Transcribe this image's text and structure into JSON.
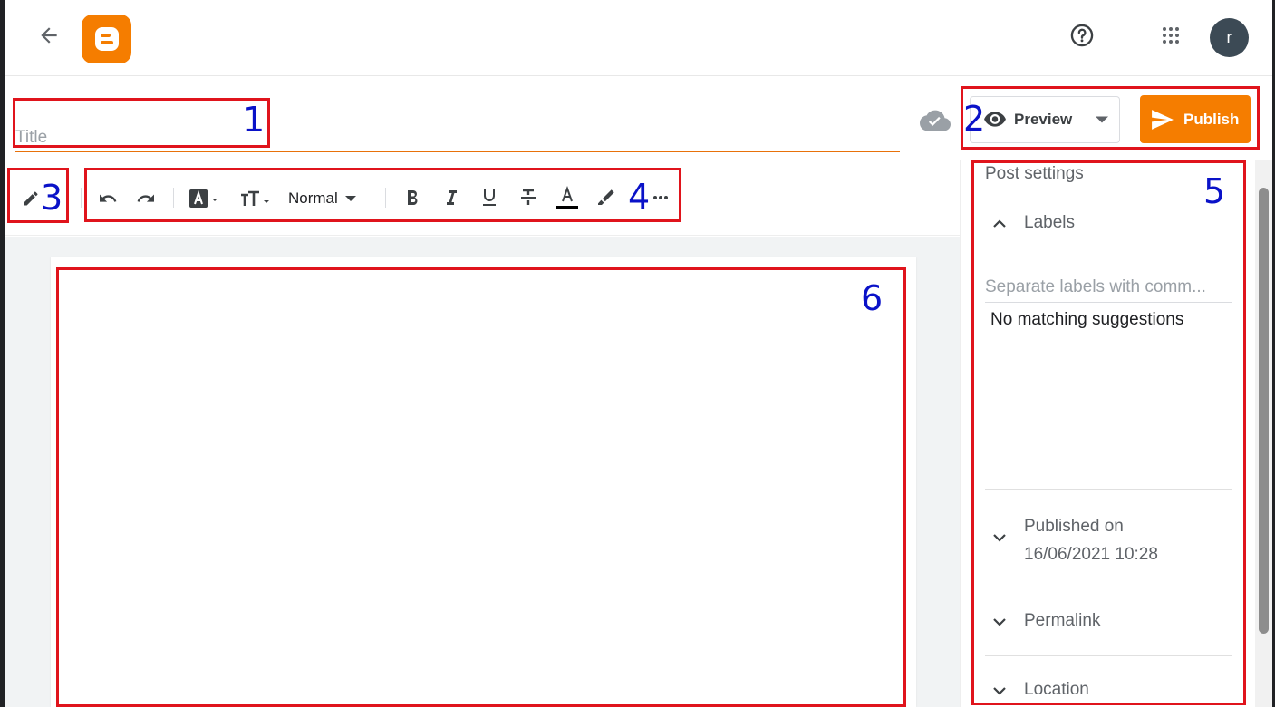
{
  "app": {
    "name": "Blogger",
    "brand_color": "#f57d00",
    "accent_line_color": "#e8710a"
  },
  "header": {
    "back_icon": "arrow-left-icon",
    "logo_icon": "blogger-logo-icon",
    "help_icon": "help-circle-icon",
    "apps_icon": "apps-grid-icon",
    "avatar_initial": "r"
  },
  "post": {
    "title_value": "",
    "title_placeholder": "Title",
    "save_status_icon": "cloud-done-icon"
  },
  "actions": {
    "preview_label": "Preview",
    "preview_icon": "eye-icon",
    "preview_menu_icon": "caret-down-icon",
    "publish_label": "Publish",
    "publish_icon": "send-icon"
  },
  "toolbar": {
    "mode_icon": "pencil-icon",
    "paragraph_style": "Normal",
    "tools": [
      "undo-icon",
      "redo-icon",
      "font-family-icon",
      "font-size-icon",
      "bold-icon",
      "italic-icon",
      "underline-icon",
      "strikethrough-icon",
      "text-color-icon",
      "highlight-icon",
      "more-icon"
    ],
    "text_color": "#000000"
  },
  "sidebar": {
    "title": "Post settings",
    "sections": {
      "labels": {
        "label": "Labels",
        "expanded": true,
        "input_value": "",
        "input_placeholder": "Separate labels with comm...",
        "suggestion_text": "No matching suggestions"
      },
      "published": {
        "label": "Published on",
        "date": "16/06/2021 10:28",
        "expanded": false
      },
      "permalink": {
        "label": "Permalink",
        "expanded": false
      },
      "location": {
        "label": "Location",
        "expanded": false
      }
    }
  },
  "annotations": {
    "box_color": "#e0141c",
    "number_color": "#0a12c8",
    "labels": [
      "1",
      "2",
      "3",
      "4",
      "5",
      "6"
    ]
  }
}
